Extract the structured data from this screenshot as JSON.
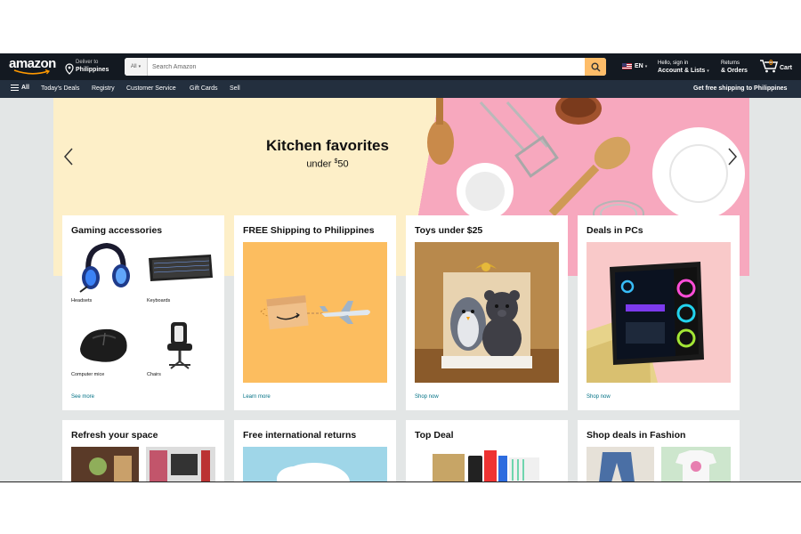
{
  "header": {
    "logo": "amazon",
    "deliver_line1": "Deliver to",
    "deliver_line2": "Philippines",
    "search_category": "All",
    "search_placeholder": "Search Amazon",
    "language": "EN",
    "account_line1": "Hello, sign in",
    "account_line2": "Account & Lists",
    "returns_line1": "Returns",
    "returns_line2": "& Orders",
    "cart_count": "0",
    "cart_label": "Cart"
  },
  "subnav": {
    "all": "All",
    "items": [
      "Today's Deals",
      "Registry",
      "Customer Service",
      "Gift Cards",
      "Sell"
    ],
    "promo": "Get free shipping to Philippines"
  },
  "hero": {
    "title": "Kitchen favorites",
    "sub_prefix": "under ",
    "sub_dollar": "$",
    "sub_amount": "50"
  },
  "cards": {
    "gaming": {
      "title": "Gaming accessories",
      "items": [
        "Headsets",
        "Keyboards",
        "Computer mice",
        "Chairs"
      ],
      "link": "See more"
    },
    "shipping": {
      "title": "FREE Shipping to Philippines",
      "link": "Learn more"
    },
    "toys": {
      "title": "Toys under $25",
      "link": "Shop now"
    },
    "pcs": {
      "title": "Deals in PCs",
      "link": "Shop now"
    },
    "refresh": {
      "title": "Refresh your space"
    },
    "returns": {
      "title": "Free international returns"
    },
    "topdeal": {
      "title": "Top Deal"
    },
    "fashion": {
      "title": "Shop deals in Fashion"
    }
  },
  "colors": {
    "nav_top": "#131921",
    "nav_bottom": "#232f3e",
    "search_button": "#febd69",
    "link": "#007185",
    "page_bg": "#e3e6e6"
  }
}
